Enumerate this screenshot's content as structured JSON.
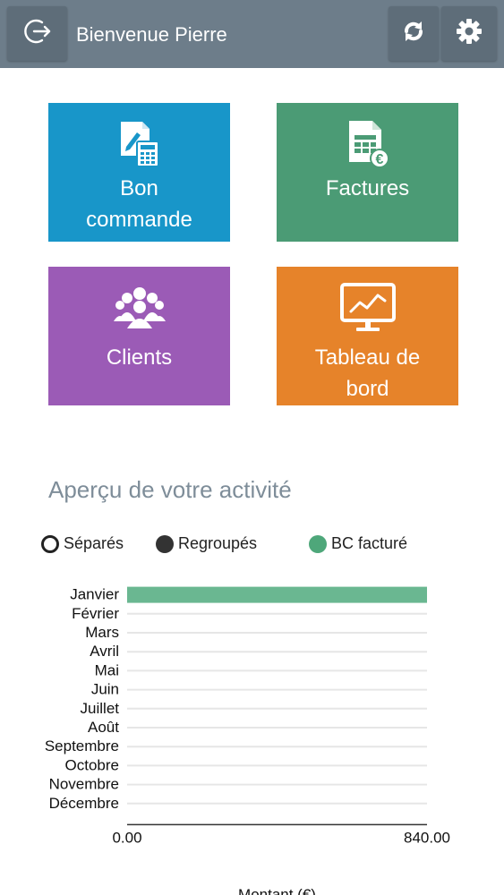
{
  "header": {
    "welcome": "Bienvenue Pierre",
    "icons": {
      "logout": "logout-icon",
      "sync": "sync-icon",
      "settings": "gear-icon"
    }
  },
  "tiles": [
    {
      "label_line1": "Bon",
      "label_line2": "commande",
      "color": "#1896c9",
      "icon": "order-form-icon"
    },
    {
      "label_line1": "Factures",
      "label_line2": "",
      "color": "#4b9b75",
      "icon": "invoice-icon"
    },
    {
      "label_line1": "Clients",
      "label_line2": "",
      "color": "#9b5bb6",
      "icon": "users-group-icon"
    },
    {
      "label_line1": "Tableau de",
      "label_line2": "bord",
      "color": "#e6832a",
      "icon": "dashboard-chart-icon"
    }
  ],
  "activity": {
    "title": "Aperçu de votre activité",
    "legend": [
      {
        "label": "Séparés",
        "style": "open"
      },
      {
        "label": "Regroupés",
        "style": "dark"
      },
      {
        "label": "BC facturé",
        "style": "green"
      }
    ]
  },
  "chart_data": {
    "type": "bar",
    "orientation": "horizontal",
    "categories": [
      "Janvier",
      "Février",
      "Mars",
      "Avril",
      "Mai",
      "Juin",
      "Juillet",
      "Août",
      "Septembre",
      "Octobre",
      "Novembre",
      "Décembre"
    ],
    "series": [
      {
        "name": "BC facturé",
        "color": "#6ab791",
        "values": [
          840,
          0,
          0,
          0,
          0,
          0,
          0,
          0,
          0,
          0,
          0,
          0
        ]
      }
    ],
    "xlim": [
      0,
      840
    ],
    "xticks": [
      "0.00",
      "840.00"
    ],
    "xlabel": "Montant (€)",
    "grid": true
  }
}
